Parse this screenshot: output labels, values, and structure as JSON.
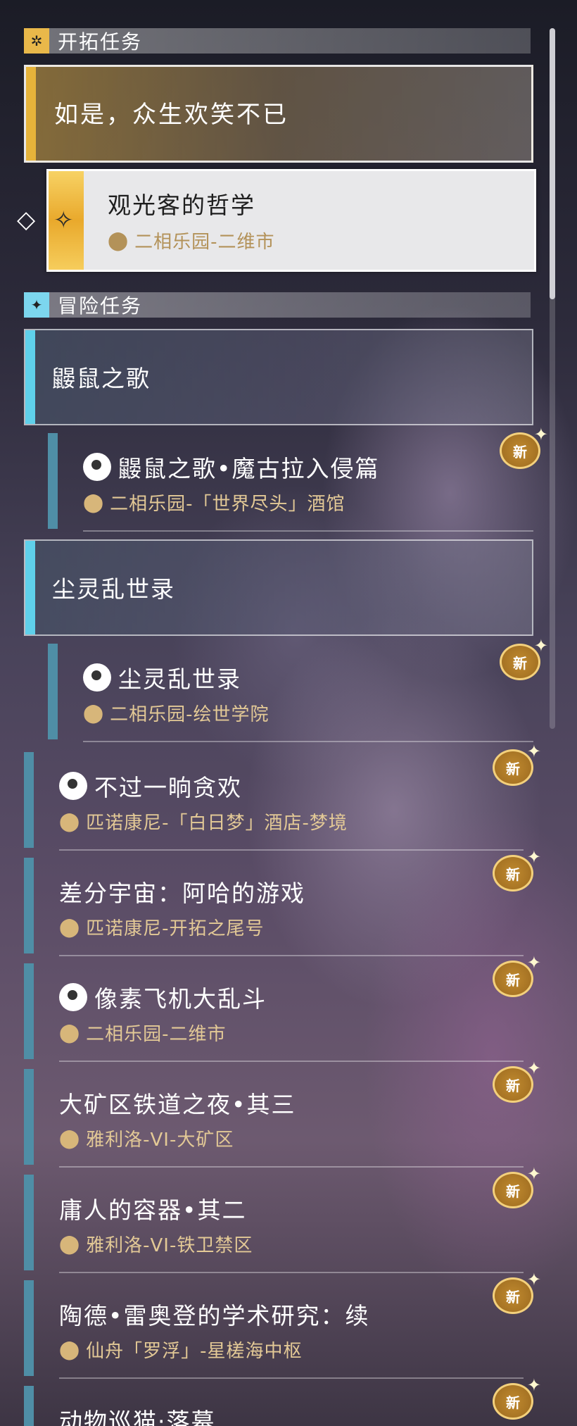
{
  "trailblaze_section": {
    "icon": "gear-icon",
    "title": "开拓任务"
  },
  "trailblaze_main": {
    "title": "如是，众生欢笑不已"
  },
  "trailblaze_sub": {
    "icon": "trailblaze-star-icon",
    "title": "观光客的哲学",
    "location": "二相乐园-二维市"
  },
  "adventure_section": {
    "icon": "diamond-star-icon",
    "title": "冒险任务"
  },
  "adventure_groups": [
    {
      "title": "鼹鼠之歌"
    },
    {
      "title": "尘灵乱世录"
    }
  ],
  "quests": [
    {
      "title": "鼹鼠之歌•魔古拉入侵篇",
      "location": "二相乐园-「世界尽头」酒馆",
      "new": "新",
      "has_icon": true
    },
    {
      "title": "尘灵乱世录",
      "location": "二相乐园-绘世学院",
      "new": "新",
      "has_icon": true
    },
    {
      "title": "不过一晌贪欢",
      "location": "匹诺康尼-「白日梦」酒店-梦境",
      "new": "新",
      "has_icon": true
    },
    {
      "title": "差分宇宙：阿哈的游戏",
      "location": "匹诺康尼-开拓之尾号",
      "new": "新",
      "has_icon": false
    },
    {
      "title": "像素飞机大乱斗",
      "location": "二相乐园-二维市",
      "new": "新",
      "has_icon": true
    },
    {
      "title": "大矿区铁道之夜•其三",
      "location": "雅利洛-VI-大矿区",
      "new": "新",
      "has_icon": false
    },
    {
      "title": "庸人的容器•其二",
      "location": "雅利洛-VI-铁卫禁区",
      "new": "新",
      "has_icon": false
    },
    {
      "title": "陶德•雷奥登的学术研究：续",
      "location": "仙舟「罗浮」-星槎海中枢",
      "new": "新",
      "has_icon": false
    },
    {
      "title": "动物巡猫·落幕",
      "location": "",
      "new": "新",
      "has_icon": false
    }
  ]
}
